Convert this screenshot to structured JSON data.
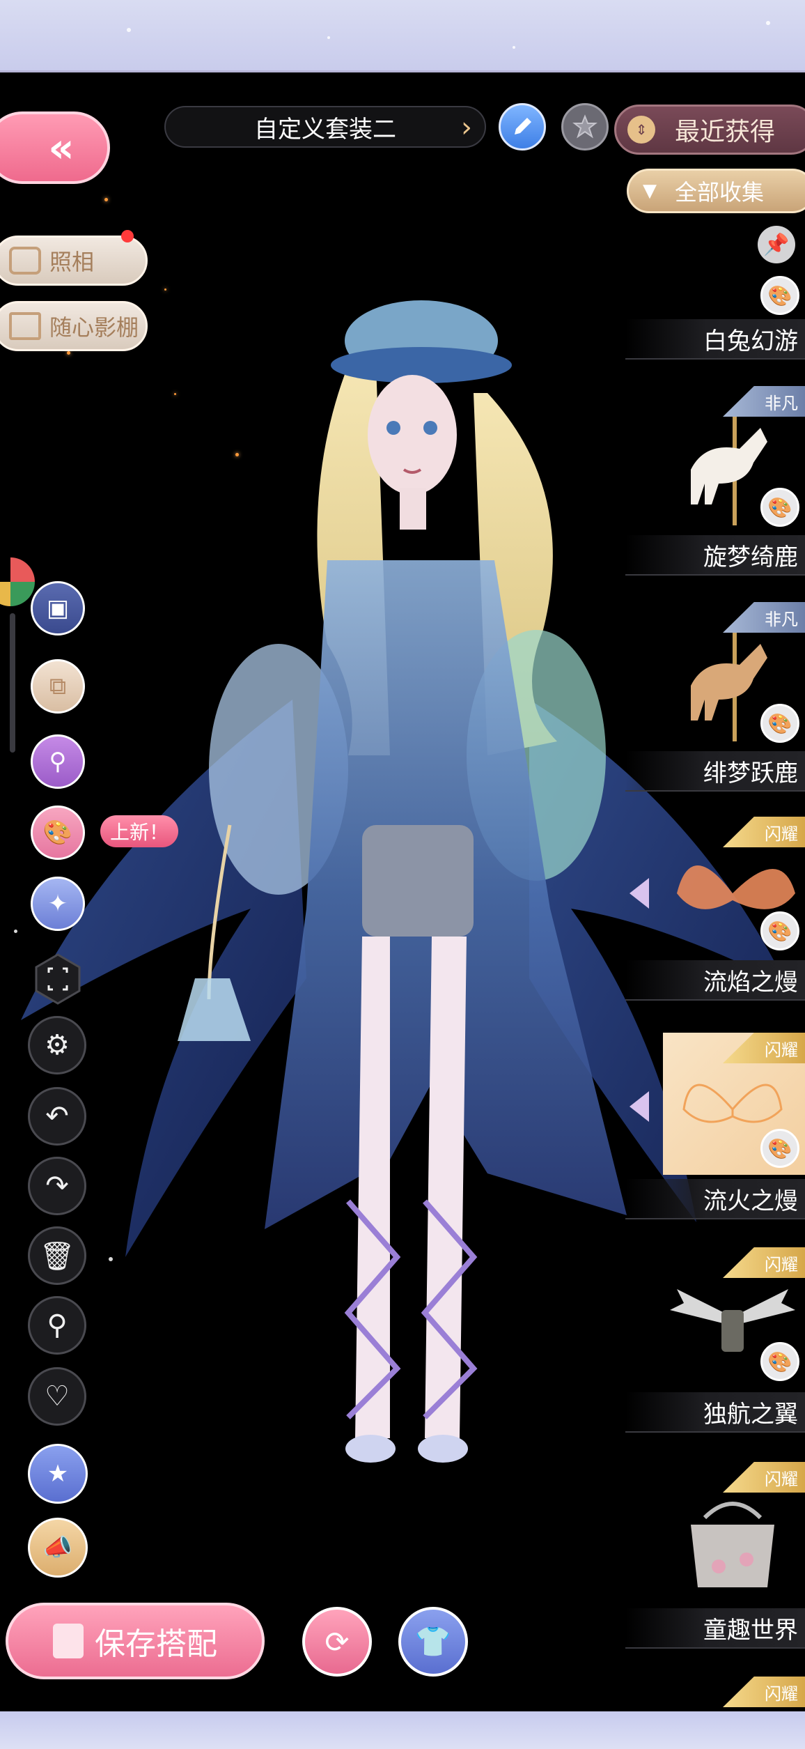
{
  "header": {
    "outfit_name": "自定义套装二",
    "recent_label": "最近获得",
    "all_collection_label": "全部收集"
  },
  "left_menu": {
    "camera_label": "照相",
    "studio_label": "随心影棚",
    "new_tag": "上新！"
  },
  "items": [
    {
      "name": "白兔幻游",
      "badge": ""
    },
    {
      "name": "旋梦绮鹿",
      "badge": "非凡"
    },
    {
      "name": "绯梦跃鹿",
      "badge": "非凡"
    },
    {
      "name": "流焰之熳",
      "badge": "闪耀"
    },
    {
      "name": "流火之熳",
      "badge": "闪耀",
      "selected": true
    },
    {
      "name": "独航之翼",
      "badge": "闪耀"
    },
    {
      "name": "童趣世界",
      "badge": "闪耀"
    },
    {
      "name": "",
      "badge": "闪耀"
    }
  ],
  "bottom": {
    "save_label": "保存搭配"
  },
  "icons": {
    "back": "double-chevron-left-icon",
    "edit": "pencil-icon",
    "favorite": "star-icon",
    "pin": "pin-icon",
    "settings": "gear-icon",
    "undo": "undo-icon",
    "redo": "redo-icon",
    "delete": "trash-icon",
    "search": "search-icon",
    "like": "heart-icon"
  },
  "colors": {
    "accent_pink": "#ef6a8d",
    "gold": "#c9a478",
    "background": "#000000"
  }
}
